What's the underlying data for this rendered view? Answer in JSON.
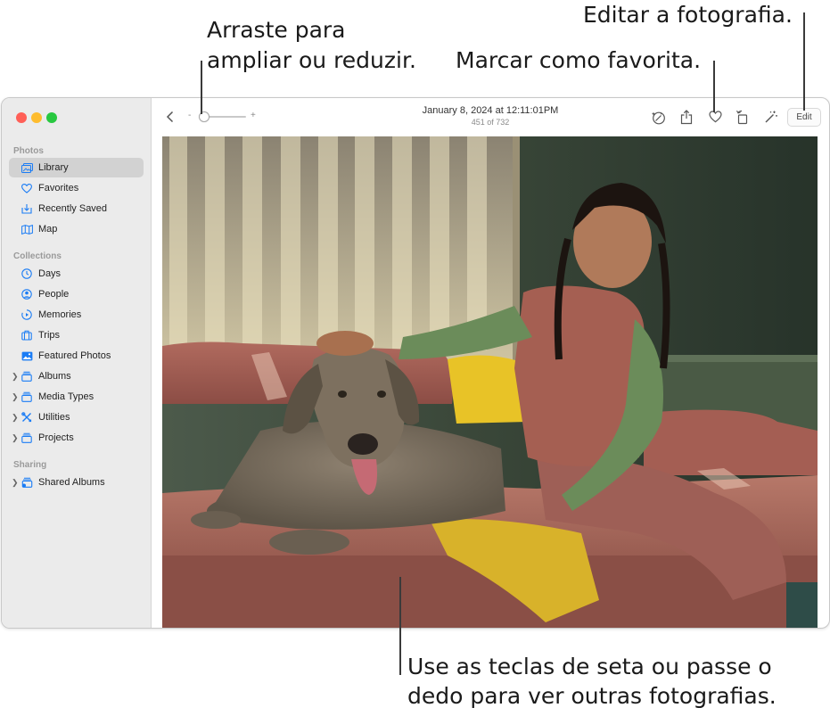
{
  "callouts": {
    "zoom_line1": "Arraste para",
    "zoom_line2": "ampliar ou reduzir.",
    "favorite": "Marcar como favorita.",
    "edit": "Editar a fotografia.",
    "browse_line1": "Use as teclas de seta ou passe o",
    "browse_line2": "dedo para ver outras fotografias."
  },
  "window": {
    "traffic_colors": [
      "#ff5f57",
      "#febc2e",
      "#28c840"
    ]
  },
  "sidebar": {
    "sections": [
      {
        "title": "Photos",
        "items": [
          {
            "label": "Library",
            "icon": "library-icon",
            "selected": true
          },
          {
            "label": "Favorites",
            "icon": "heart-icon"
          },
          {
            "label": "Recently Saved",
            "icon": "download-icon"
          },
          {
            "label": "Map",
            "icon": "map-icon"
          }
        ]
      },
      {
        "title": "Collections",
        "items": [
          {
            "label": "Days",
            "icon": "clock-icon"
          },
          {
            "label": "People",
            "icon": "person-icon"
          },
          {
            "label": "Memories",
            "icon": "memories-icon"
          },
          {
            "label": "Trips",
            "icon": "suitcase-icon"
          },
          {
            "label": "Featured Photos",
            "icon": "photo-icon"
          },
          {
            "label": "Albums",
            "icon": "stack-icon",
            "expandable": true
          },
          {
            "label": "Media Types",
            "icon": "stack-icon",
            "expandable": true
          },
          {
            "label": "Utilities",
            "icon": "tools-icon",
            "expandable": true
          },
          {
            "label": "Projects",
            "icon": "stack-icon",
            "expandable": true
          }
        ]
      },
      {
        "title": "Sharing",
        "items": [
          {
            "label": "Shared Albums",
            "icon": "shared-stack-icon",
            "expandable": true
          }
        ]
      }
    ]
  },
  "toolbar": {
    "title": "January 8, 2024 at 12:11:01PM",
    "subtitle": "451 of 732",
    "edit_label": "Edit",
    "zoom_minus": "-",
    "zoom_plus": "+",
    "zoom_level": 0.0
  },
  "colors": {
    "accent": "#1a7cf5",
    "sidebar_bg": "#ebebeb",
    "selected_bg": "#d2d2d2"
  }
}
